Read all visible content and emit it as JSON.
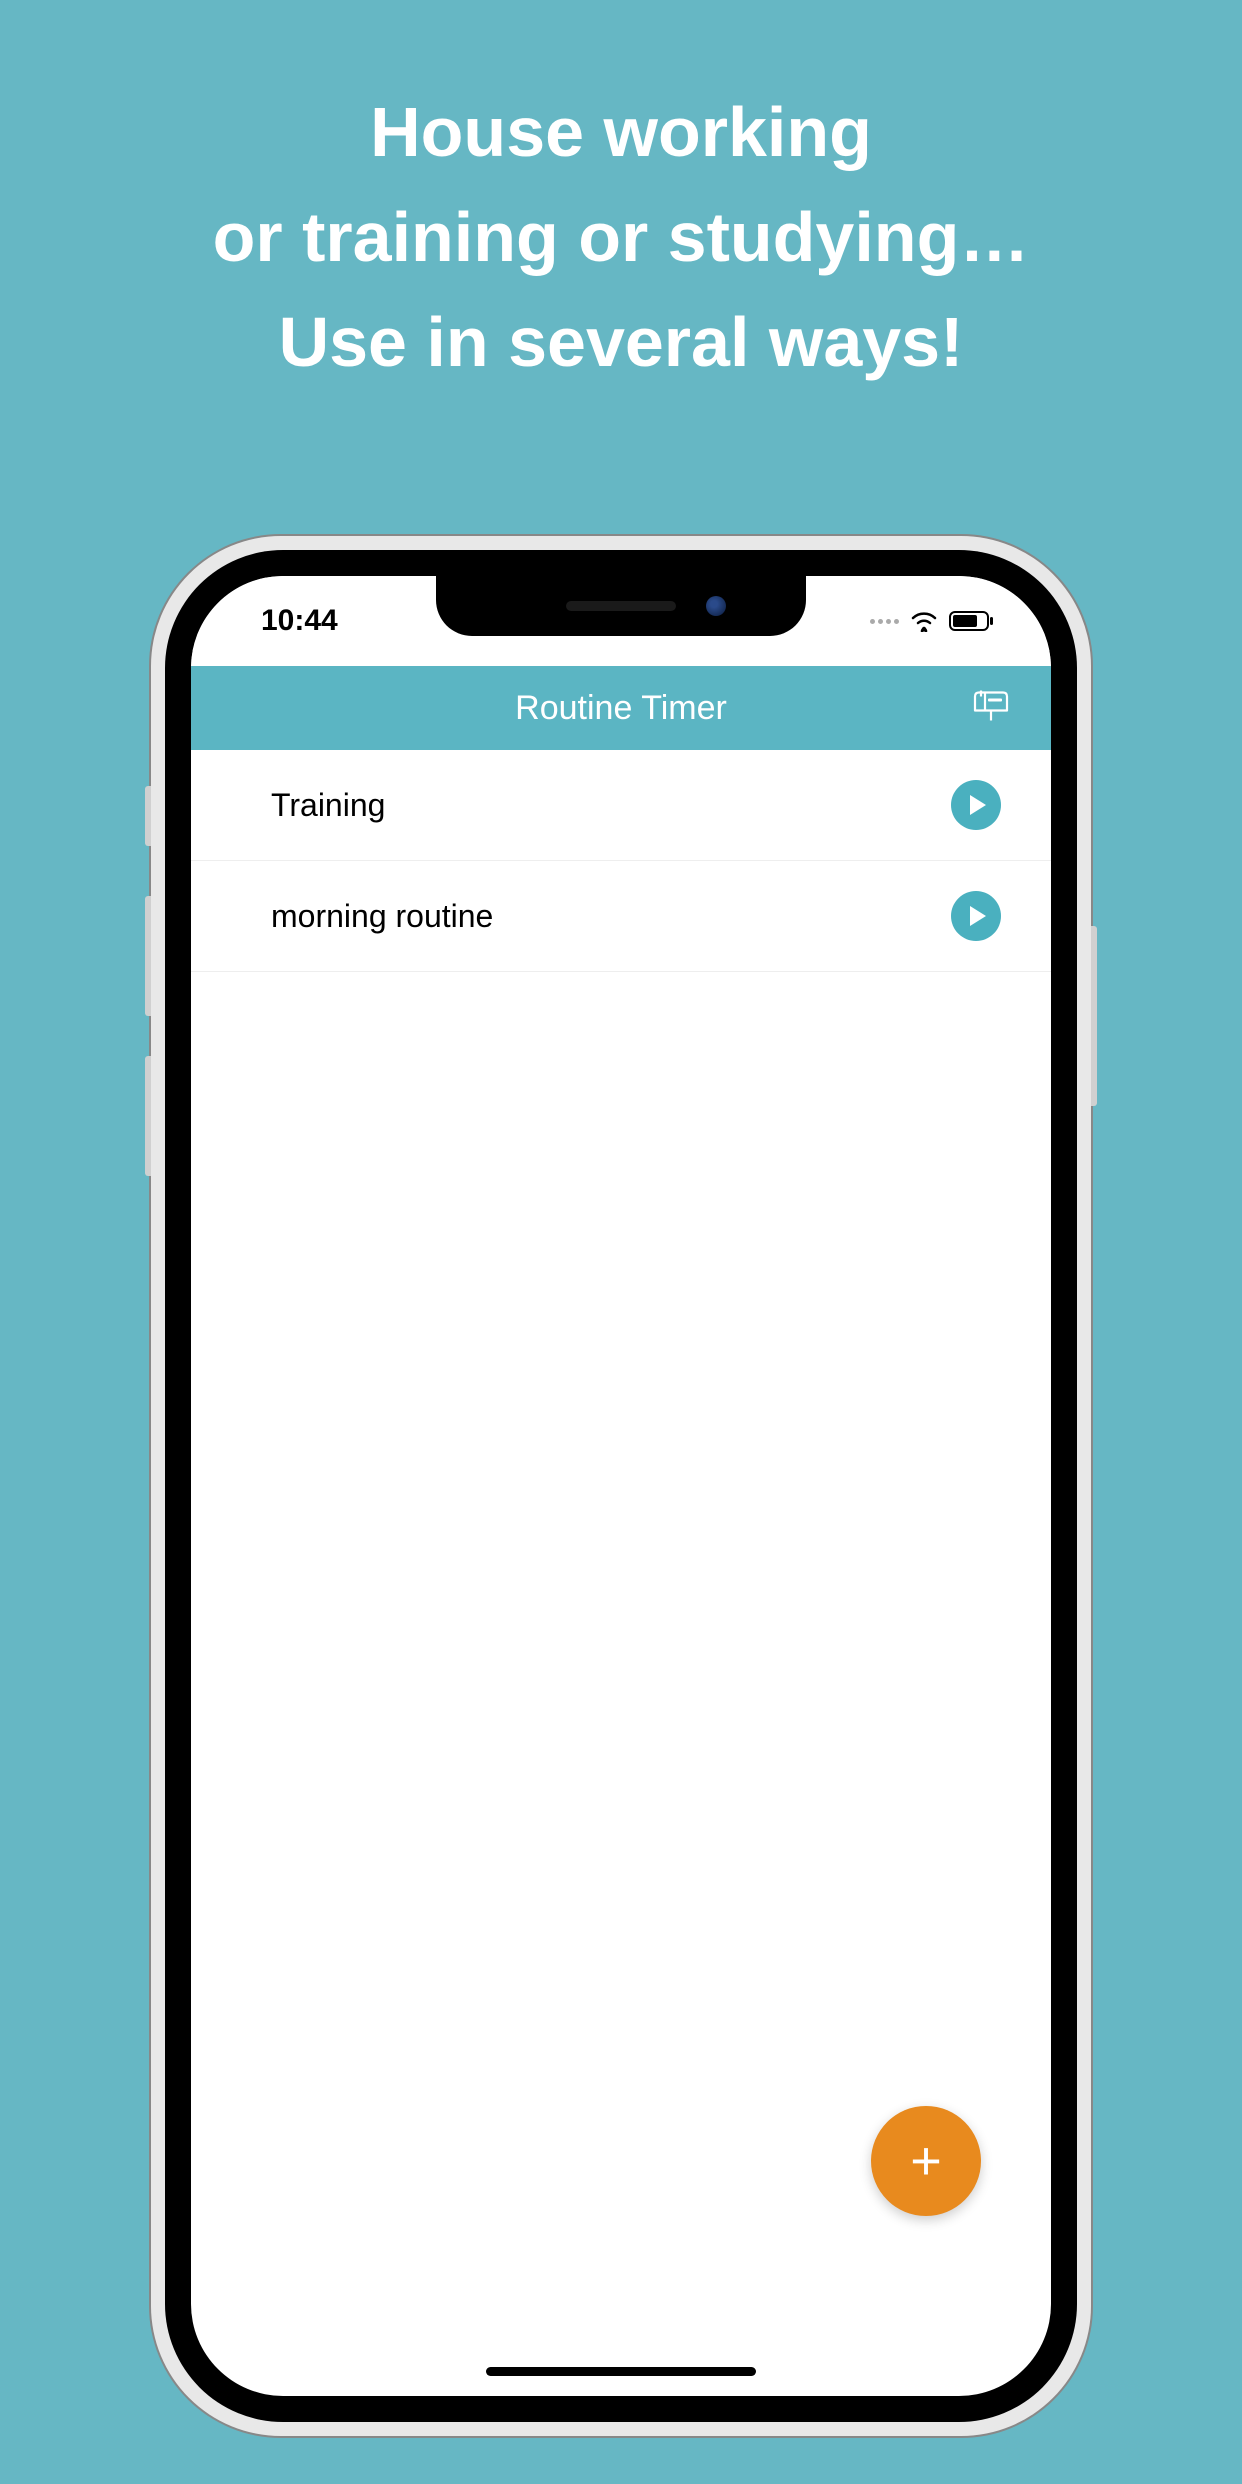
{
  "promo": {
    "line1": "House working",
    "line2": "or training or studying…",
    "line3": "Use in several ways!"
  },
  "status": {
    "time": "10:44"
  },
  "header": {
    "title": "Routine Timer"
  },
  "routines": [
    {
      "label": "Training"
    },
    {
      "label": "morning routine"
    }
  ],
  "fab": {
    "label": "+"
  }
}
